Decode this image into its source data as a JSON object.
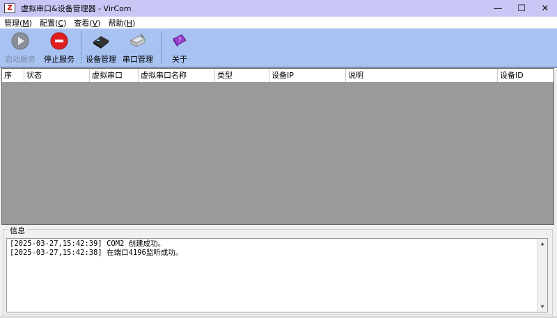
{
  "window": {
    "title": "虚拟串口&设备管理器 - VirCom",
    "icon_glyph": "Z",
    "minimize": "—",
    "maximize": "☐",
    "close": "✕"
  },
  "menu": [
    {
      "label": "管理(",
      "key": "M",
      "tail": ")"
    },
    {
      "label": "配置(",
      "key": "C",
      "tail": ")"
    },
    {
      "label": "查看(",
      "key": "V",
      "tail": ")"
    },
    {
      "label": "帮助(",
      "key": "H",
      "tail": ")"
    }
  ],
  "toolbar": {
    "start": "启动服务",
    "stop": "停止服务",
    "device": "设备管理",
    "port": "串口管理",
    "about": "关于"
  },
  "table": {
    "columns": [
      "序",
      "状态",
      "虚拟串口",
      "虚拟串口名称",
      "类型",
      "设备IP",
      "说明",
      "设备ID"
    ]
  },
  "info": {
    "legend": "信息",
    "lines": [
      "[2025-03-27,15:42:39] COM2 创建成功。",
      "[2025-03-27,15:42:38] 在端口4196监听成功。"
    ]
  },
  "colors": {
    "titlebar": "#c9c7f5",
    "toolbar": "#a8c2f1",
    "grid_bg": "#9a9a9a"
  }
}
